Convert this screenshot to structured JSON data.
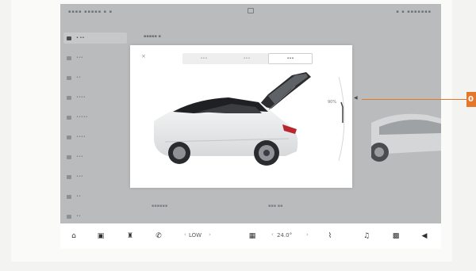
{
  "sidebar": {
    "items": [
      {
        "label": "• ••"
      },
      {
        "label": "•••"
      },
      {
        "label": "••"
      },
      {
        "label": "••••"
      },
      {
        "label": "•••••"
      },
      {
        "label": "••••"
      },
      {
        "label": "•••"
      },
      {
        "label": "•••"
      },
      {
        "label": "••"
      },
      {
        "label": "••"
      }
    ]
  },
  "dialog": {
    "close": "×",
    "tabs": [
      {
        "label": "•••"
      },
      {
        "label": "•••"
      },
      {
        "label": "•••"
      }
    ],
    "percent": "90%"
  },
  "callout": {
    "label": "0"
  },
  "dock": {
    "fan_level": "LOW",
    "temperature": "24.0°",
    "icons": [
      "home-icon",
      "car-icon",
      "seat-icon",
      "phone-icon",
      "fan-icon",
      "heated-seat-icon",
      "wiper-icon",
      "music-icon",
      "apps-icon",
      "volume-icon"
    ]
  },
  "colors": {
    "accent": "#e6772a",
    "screen_bg": "#b9bbbd",
    "dialog_bg": "#ffffff"
  }
}
